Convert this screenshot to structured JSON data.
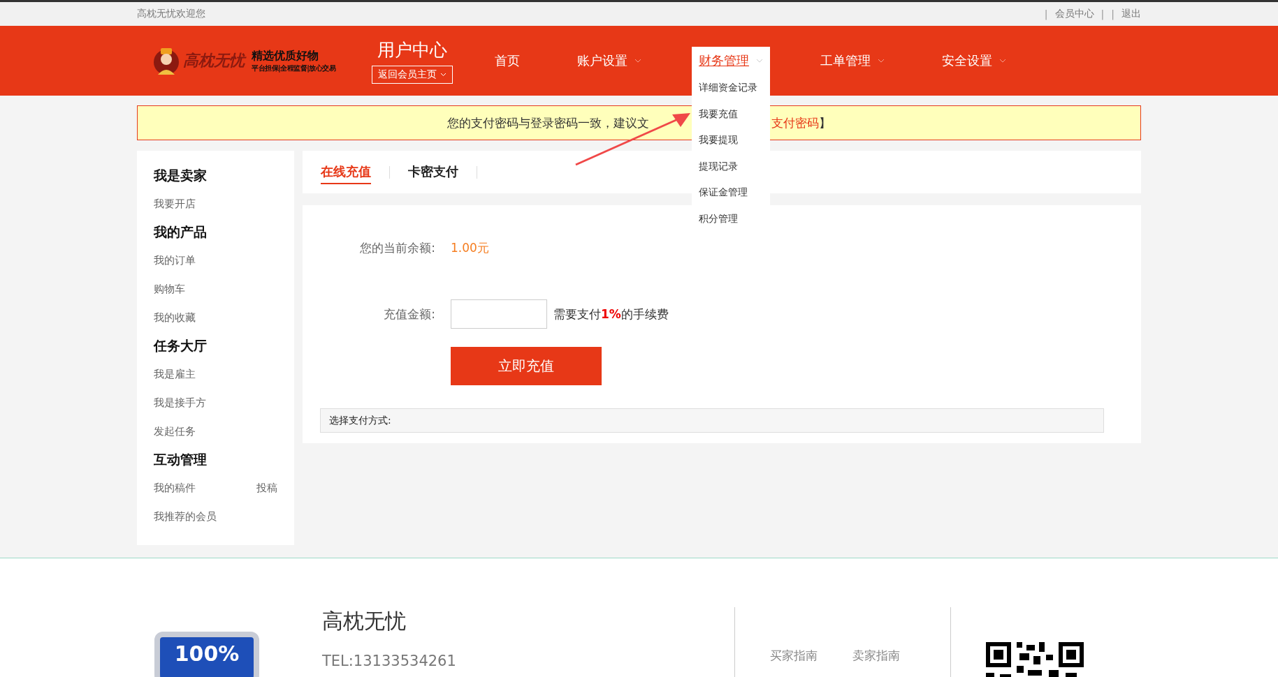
{
  "top_bar": {
    "welcome": "高枕无忧欢迎您",
    "links": [
      {
        "sep_before": "|",
        "label": "会员中心",
        "sep_after": "|"
      },
      {
        "sep_before": "|",
        "label": "退出"
      }
    ]
  },
  "header": {
    "logo_text": "高枕无忧",
    "slogan": "精选优质好物",
    "slogan_sub": "平台担保|全程监督|放心交易",
    "user_center": "用户中心",
    "back_button": "返回会员主页",
    "nav": [
      {
        "label": "首页",
        "dropdown": false,
        "selected": false
      },
      {
        "label": "账户设置",
        "dropdown": true,
        "selected": false
      },
      {
        "label": "财务管理",
        "dropdown": true,
        "selected": true,
        "menu": [
          "详细资金记录",
          "我要充值",
          "我要提现",
          "提现记录",
          "保证金管理",
          "积分管理"
        ]
      },
      {
        "label": "工单管理",
        "dropdown": true,
        "selected": false
      },
      {
        "label": "安全设置",
        "dropdown": true,
        "selected": false
      }
    ]
  },
  "notice": {
    "text": "您的支付密码与登录密码一致，建议文",
    "link": "支付密码",
    "suffix": "】"
  },
  "sidebar": [
    {
      "heading": "我是卖家",
      "items": [
        {
          "label": "我要开店"
        }
      ]
    },
    {
      "heading": "我的产品",
      "items": [
        {
          "label": "我的订单"
        },
        {
          "label": "购物车"
        },
        {
          "label": "我的收藏"
        }
      ]
    },
    {
      "heading": "任务大厅",
      "items": [
        {
          "label": "我是雇主"
        },
        {
          "label": "我是接手方"
        },
        {
          "label": "发起任务"
        }
      ]
    },
    {
      "heading": "互动管理",
      "items": [
        {
          "label": "我的稿件",
          "extra": "投稿"
        },
        {
          "label": "我推荐的会员"
        }
      ]
    }
  ],
  "tabs": [
    {
      "label": "在线充值",
      "selected": true
    },
    {
      "label": "卡密支付",
      "selected": false
    }
  ],
  "form": {
    "balance_label": "您的当前余额:",
    "balance": "1.00元",
    "amount_label": "充值金额:",
    "fee_note": "需要支付**1%**的手续费",
    "submit": "立即充值",
    "payment_label": "选择支付方式:"
  },
  "footer": {
    "badge": "100%",
    "brand": "高枕无忧",
    "tel": "TEL:13133534261",
    "links": [
      "买家指南",
      "卖家指南"
    ]
  }
}
